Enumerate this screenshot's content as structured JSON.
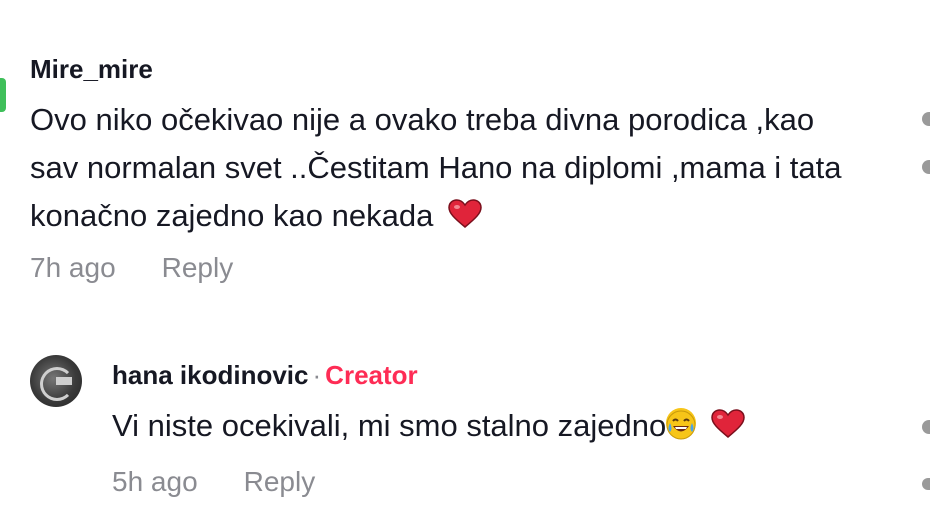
{
  "comment": {
    "username": "Mire_mire",
    "text": "Ovo niko očekivao nije a ovako treba divna porodica ,kao sav normalan svet ..Čestitam Hano na diplomi ,mama i tata konačno zajedno kao nekada",
    "time": "7h ago",
    "reply_label": "Reply",
    "emoji": "heart-icon"
  },
  "reply": {
    "username": "hana ikodinovic",
    "separator": "·",
    "badge": "Creator",
    "text": "Vi niste ocekivali, mi smo stalno zajedno",
    "time": "5h ago",
    "reply_label": "Reply",
    "emojis": [
      "laughing-tears-icon",
      "heart-icon"
    ]
  },
  "colors": {
    "text": "#161823",
    "muted": "#8a8b91",
    "creator": "#fe2c55",
    "heart": "#e0243a"
  }
}
